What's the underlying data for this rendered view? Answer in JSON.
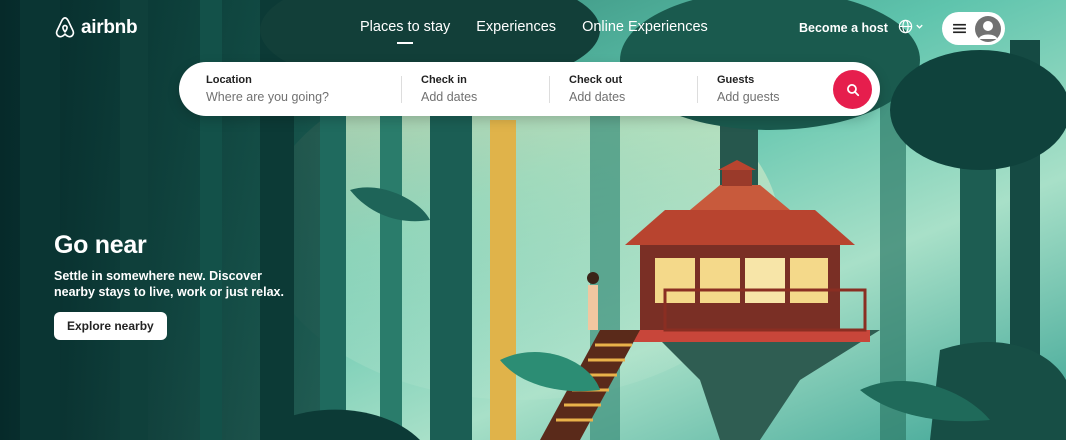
{
  "brand": {
    "name": "airbnb",
    "color": "#ff385c"
  },
  "nav": {
    "items": [
      {
        "label": "Places to stay",
        "active": true
      },
      {
        "label": "Experiences",
        "active": false
      },
      {
        "label": "Online Experiences",
        "active": false
      }
    ]
  },
  "header": {
    "host_label": "Become a host",
    "language_icon": "globe-icon",
    "menu_icon": "hamburger-icon",
    "avatar_icon": "user-avatar-icon"
  },
  "search": {
    "fields": [
      {
        "label": "Location",
        "placeholder": "Where are you going?"
      },
      {
        "label": "Check in",
        "placeholder": "Add dates"
      },
      {
        "label": "Check out",
        "placeholder": "Add dates"
      },
      {
        "label": "Guests",
        "placeholder": "Add guests"
      }
    ],
    "button_icon": "search-icon",
    "button_color": "#e61e4d"
  },
  "hero": {
    "title": "Go near",
    "subtitle": "Settle in somewhere new. Discover nearby stays to live, work or just relax.",
    "cta_label": "Explore nearby",
    "image": "treehouse-forest-illustration"
  }
}
